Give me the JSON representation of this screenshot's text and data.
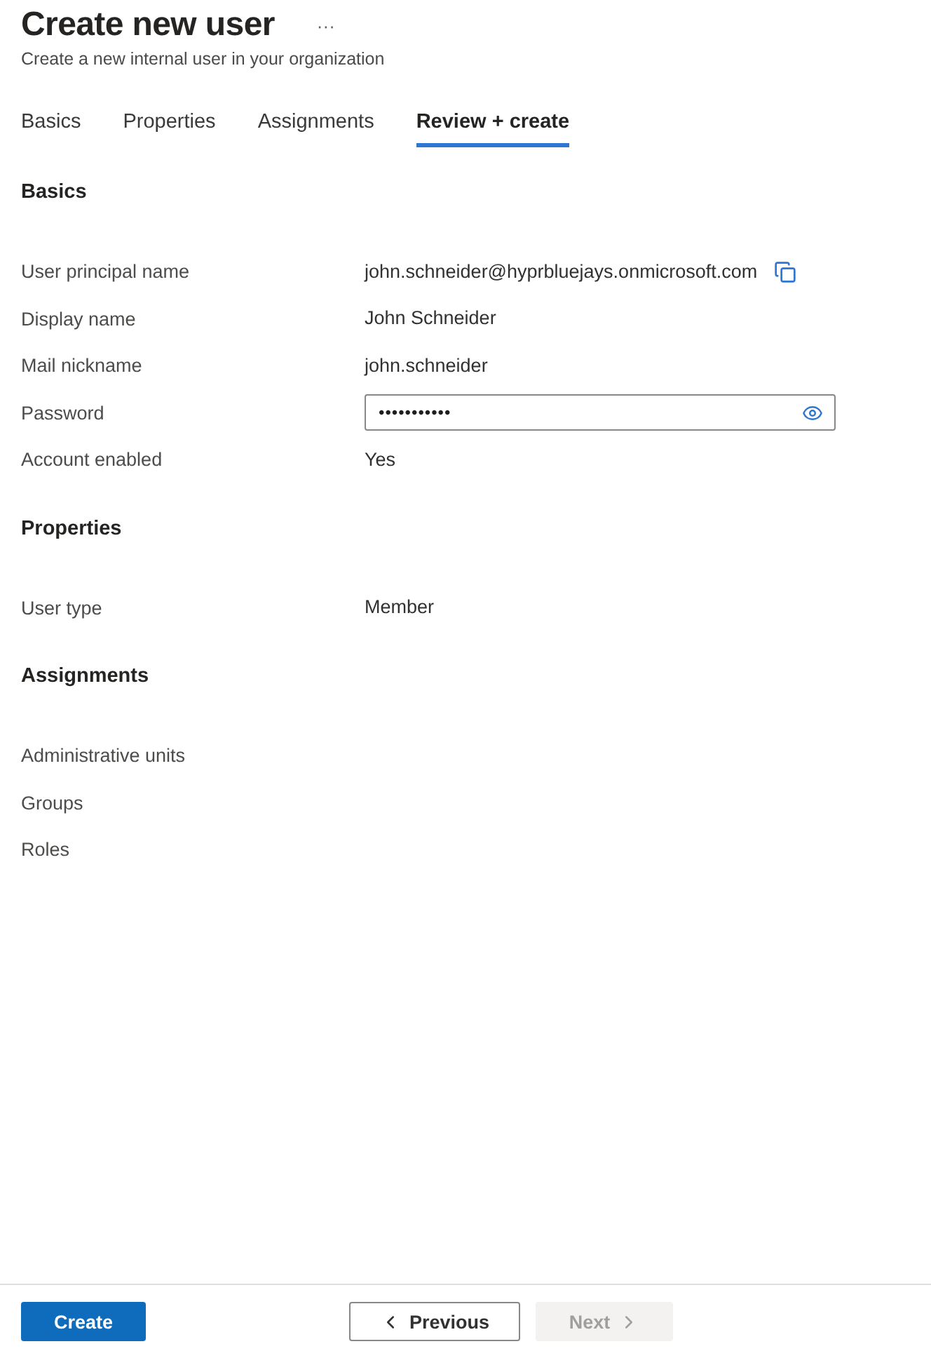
{
  "header": {
    "title": "Create new user",
    "more": "···",
    "subtitle": "Create a new internal user in your organization"
  },
  "tabs": [
    {
      "label": "Basics",
      "selected": false
    },
    {
      "label": "Properties",
      "selected": false
    },
    {
      "label": "Assignments",
      "selected": false
    },
    {
      "label": "Review + create",
      "selected": true
    }
  ],
  "sections": [
    {
      "title": "Basics",
      "rows": [
        {
          "kind": "copy",
          "label": "User principal name",
          "value": "john.schneider@hyprbluejays.onmicrosoft.com"
        },
        {
          "kind": "text",
          "label": "Display name",
          "value": "John Schneider"
        },
        {
          "kind": "text",
          "label": "Mail nickname",
          "value": "john.schneider"
        },
        {
          "kind": "password",
          "label": "Password",
          "value": "•••••••••••"
        },
        {
          "kind": "text",
          "label": "Account enabled",
          "value": "Yes"
        }
      ]
    },
    {
      "title": "Properties",
      "rows": [
        {
          "kind": "text",
          "label": "User type",
          "value": "Member"
        }
      ]
    },
    {
      "title": "Assignments",
      "rows": [
        {
          "kind": "text",
          "label": "Administrative units"
        },
        {
          "kind": "text",
          "label": "Groups"
        },
        {
          "kind": "text",
          "label": "Roles"
        }
      ]
    }
  ],
  "footer": {
    "buttons": [
      {
        "kind": "primary",
        "label": "Create",
        "disabled": false
      },
      {
        "kind": "previous",
        "label": "Previous",
        "disabled": false
      },
      {
        "kind": "next",
        "label": "Next",
        "disabled": true
      }
    ]
  }
}
